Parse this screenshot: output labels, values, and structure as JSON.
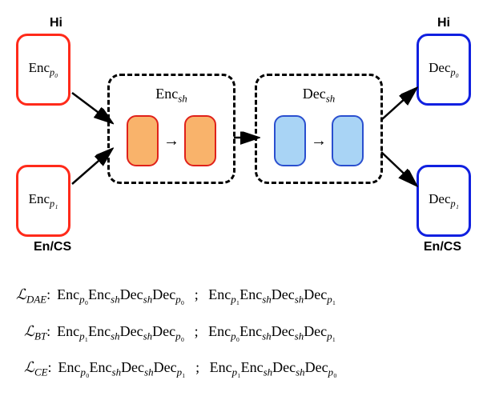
{
  "labels": {
    "hi_left": "Hi",
    "hi_right": "Hi",
    "encs_left": "En/CS",
    "encs_right": "En/CS"
  },
  "blocks": {
    "enc_p0": "Enc",
    "enc_p0_sub": "p₀",
    "enc_p1": "Enc",
    "enc_p1_sub": "p₁",
    "enc_sh": "Enc",
    "enc_sh_sub": "sh",
    "dec_sh": "Dec",
    "dec_sh_sub": "sh",
    "dec_p0": "Dec",
    "dec_p0_sub": "p₀",
    "dec_p1": "Dec",
    "dec_p1_sub": "p₁"
  },
  "equations": {
    "dae_label": "ℒ",
    "dae_sub": "DAE",
    "dae_lhs": "Enc_{p₀}Enc_{sh}Dec_{sh}Dec_{p₀}",
    "dae_rhs": "Enc_{p₁}Enc_{sh}Dec_{sh}Dec_{p₁}",
    "bt_label": "ℒ",
    "bt_sub": "BT",
    "bt_lhs": "Enc_{p₁}Enc_{sh}Dec_{sh}Dec_{p₀}",
    "bt_rhs": "Enc_{p₀}Enc_{sh}Dec_{sh}Dec_{p₁}",
    "ce_label": "ℒ",
    "ce_sub": "CE",
    "ce_lhs": "Enc_{p₀}Enc_{sh}Dec_{sh}Dec_{p₁}",
    "ce_rhs": "Enc_{p₁}Enc_{sh}Dec_{sh}Dec_{p₀}",
    "sep": ";",
    "colon": ":"
  },
  "chart_data": {
    "type": "diagram",
    "nodes": [
      {
        "id": "enc_p0",
        "label": "Enc_{p0}",
        "lang": "Hi",
        "color": "red",
        "role": "private-encoder"
      },
      {
        "id": "enc_p1",
        "label": "Enc_{p1}",
        "lang": "En/CS",
        "color": "red",
        "role": "private-encoder"
      },
      {
        "id": "enc_sh",
        "label": "Enc_{sh}",
        "color": "orange",
        "role": "shared-encoder",
        "layers": 2
      },
      {
        "id": "dec_sh",
        "label": "Dec_{sh}",
        "color": "lightblue",
        "role": "shared-decoder",
        "layers": 2
      },
      {
        "id": "dec_p0",
        "label": "Dec_{p0}",
        "lang": "Hi",
        "color": "blue",
        "role": "private-decoder"
      },
      {
        "id": "dec_p1",
        "label": "Dec_{p1}",
        "lang": "En/CS",
        "color": "blue",
        "role": "private-decoder"
      }
    ],
    "edges": [
      {
        "from": "enc_p0",
        "to": "enc_sh"
      },
      {
        "from": "enc_p1",
        "to": "enc_sh"
      },
      {
        "from": "enc_sh",
        "to": "dec_sh"
      },
      {
        "from": "dec_sh",
        "to": "dec_p0"
      },
      {
        "from": "dec_sh",
        "to": "dec_p1"
      }
    ],
    "losses": [
      {
        "name": "L_DAE",
        "paths": [
          "Enc_{p0} Enc_{sh} Dec_{sh} Dec_{p0}",
          "Enc_{p1} Enc_{sh} Dec_{sh} Dec_{p1}"
        ]
      },
      {
        "name": "L_BT",
        "paths": [
          "Enc_{p1} Enc_{sh} Dec_{sh} Dec_{p0}",
          "Enc_{p0} Enc_{sh} Dec_{sh} Dec_{p1}"
        ]
      },
      {
        "name": "L_CE",
        "paths": [
          "Enc_{p0} Enc_{sh} Dec_{sh} Dec_{p1}",
          "Enc_{p1} Enc_{sh} Dec_{sh} Dec_{p0}"
        ]
      }
    ]
  }
}
